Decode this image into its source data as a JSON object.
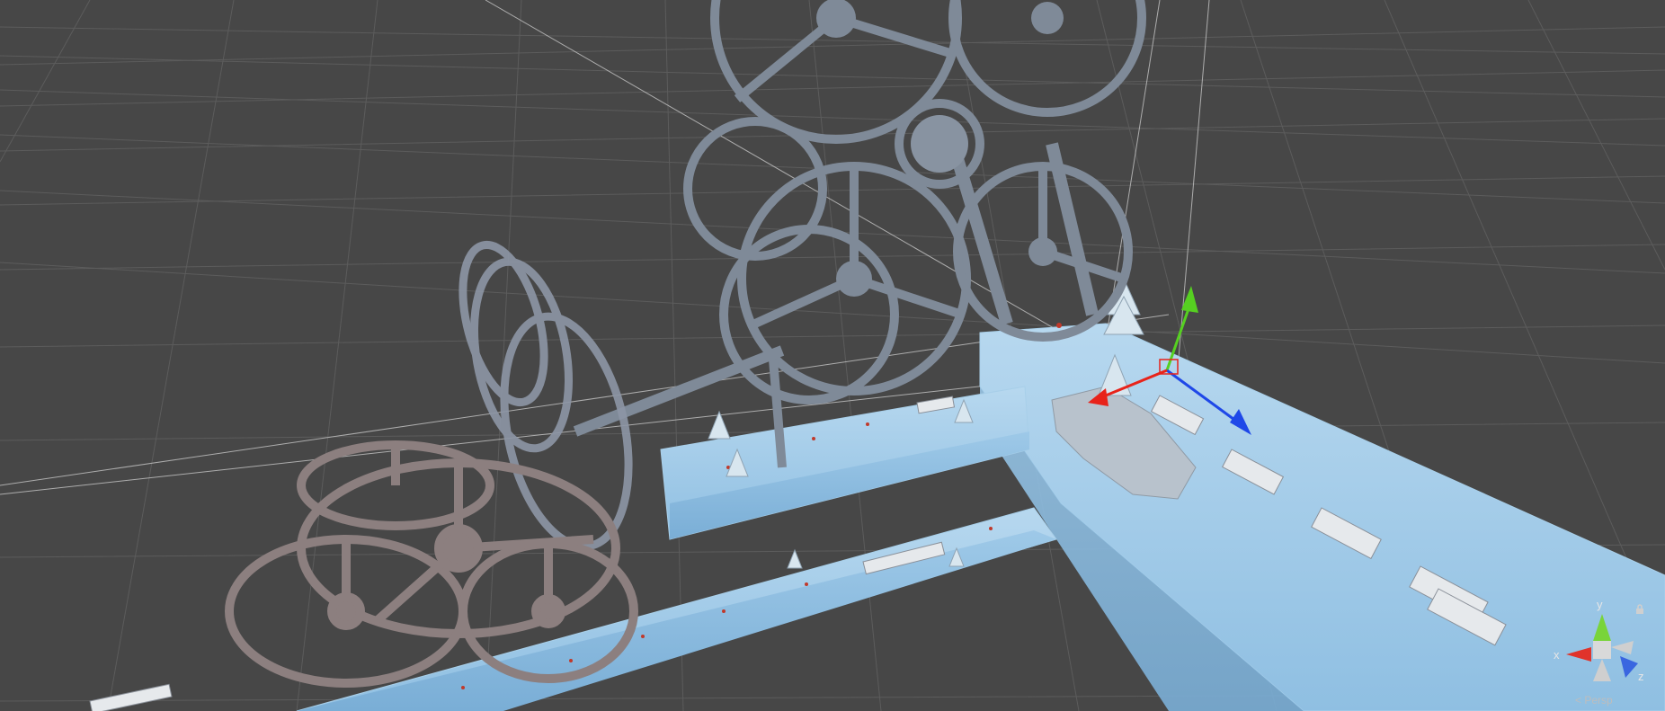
{
  "scene_view": {
    "background": "#474747",
    "grid_color": "#5a5a5a"
  },
  "scene_gizmo": {
    "axis_y": "y",
    "axis_x": "x",
    "axis_z": "z",
    "projection_label": "< Persp",
    "colors": {
      "x": "#e0332b",
      "y": "#79d43a",
      "z": "#3a66e0"
    },
    "icons": {
      "lock": "lock-icon"
    }
  },
  "transform_gizmo": {
    "colors": {
      "x": "#e8231a",
      "y": "#56d021",
      "z": "#1f48e8"
    },
    "icons": {
      "move": "move-tool-icon"
    }
  }
}
